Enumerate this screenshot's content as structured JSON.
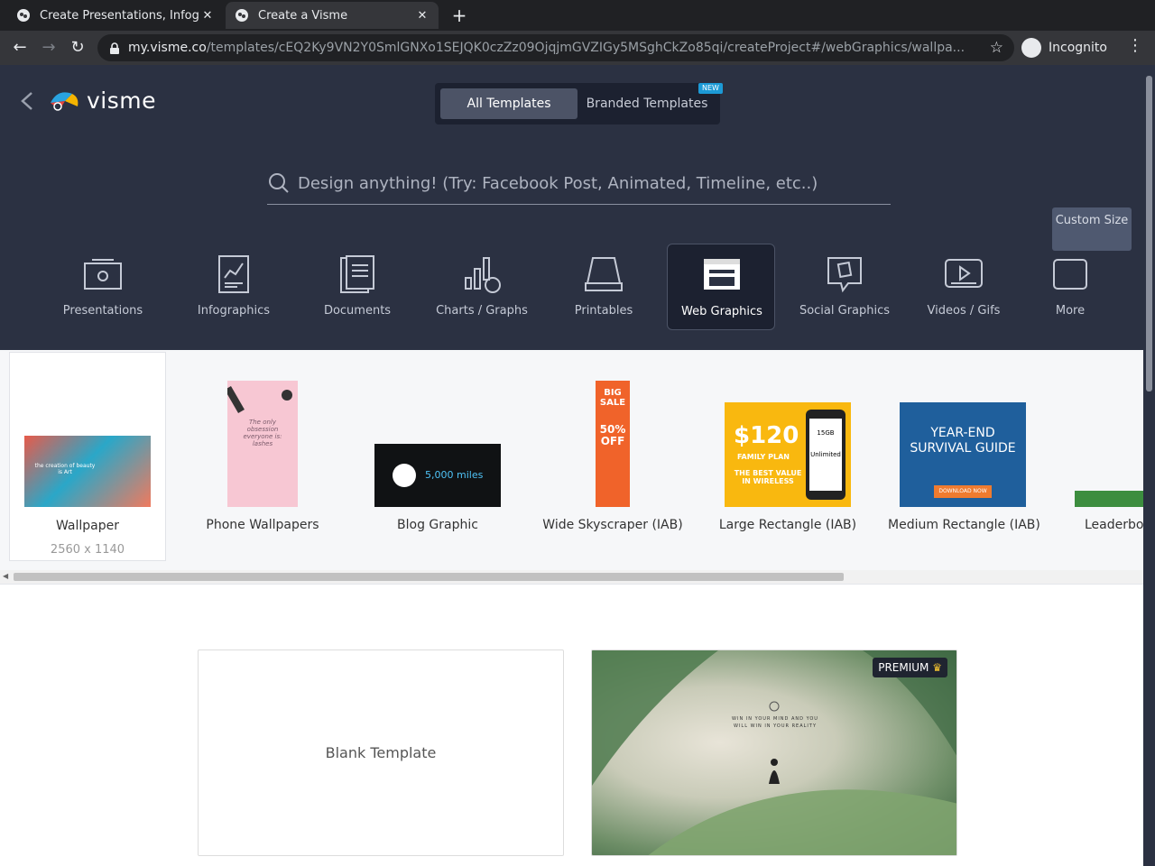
{
  "browser": {
    "tabs": [
      {
        "title": "Create Presentations, Infog",
        "active": false
      },
      {
        "title": "Create a Visme",
        "active": true
      }
    ],
    "url_host": "my.visme.co",
    "url_path": "/templates/cEQ2Ky9VN2Y0SmlGNXo1SEJQK0czZz09OjqjmGVZIGy5MSghCkZo85qi/createProject#/webGraphics/wallpa...",
    "profile_label": "Incognito"
  },
  "app": {
    "logo_text": "visme",
    "toggle": {
      "all": "All Templates",
      "branded": "Branded Templates",
      "new_badge": "NEW"
    },
    "search_placeholder": "Design anything! (Try: Facebook Post, Animated, Timeline, etc..)",
    "categories": [
      {
        "label": "Presentations",
        "icon": "presentation-icon"
      },
      {
        "label": "Infographics",
        "icon": "infographic-icon"
      },
      {
        "label": "Documents",
        "icon": "document-icon"
      },
      {
        "label": "Charts / Graphs",
        "icon": "chart-icon"
      },
      {
        "label": "Printables",
        "icon": "printer-icon"
      },
      {
        "label": "Web Graphics",
        "icon": "web-graphics-icon",
        "active": true
      },
      {
        "label": "Social Graphics",
        "icon": "social-icon"
      },
      {
        "label": "Videos / Gifs",
        "icon": "video-icon"
      },
      {
        "label": "More",
        "icon": "more-icon"
      }
    ],
    "custom_size_label": "Custom Size",
    "subtypes": [
      {
        "name": "Wallpaper",
        "dims": "2560 x 1140",
        "selected": true
      },
      {
        "name": "Phone Wallpapers"
      },
      {
        "name": "Blog Graphic"
      },
      {
        "name": "Wide Skyscraper (IAB)"
      },
      {
        "name": "Large Rectangle (IAB)"
      },
      {
        "name": "Medium Rectangle (IAB)"
      },
      {
        "name": "Leaderboard"
      }
    ],
    "thumb_text": {
      "wallpaper": "the creation of beauty is Art",
      "phone": "The only obsession everyone is: lashes",
      "blog": "5,000 miles",
      "sky_big": "BIG SALE",
      "sky_pct": "50% OFF",
      "large_price": "$120",
      "large_plan": "FAMILY PLAN",
      "large_tag": "THE BEST VALUE IN WIRELESS",
      "large_phone": "15GB",
      "large_unlim": "Unlimited",
      "medium_title": "YEAR-END SURVIVAL GUIDE",
      "medium_btn": "DOWNLOAD NOW"
    },
    "templates": {
      "blank_label": "Blank Template",
      "premium_label": "PREMIUM",
      "premium_text": "WIN IN YOUR MIND AND YOU WILL WIN IN YOUR REALITY"
    }
  }
}
